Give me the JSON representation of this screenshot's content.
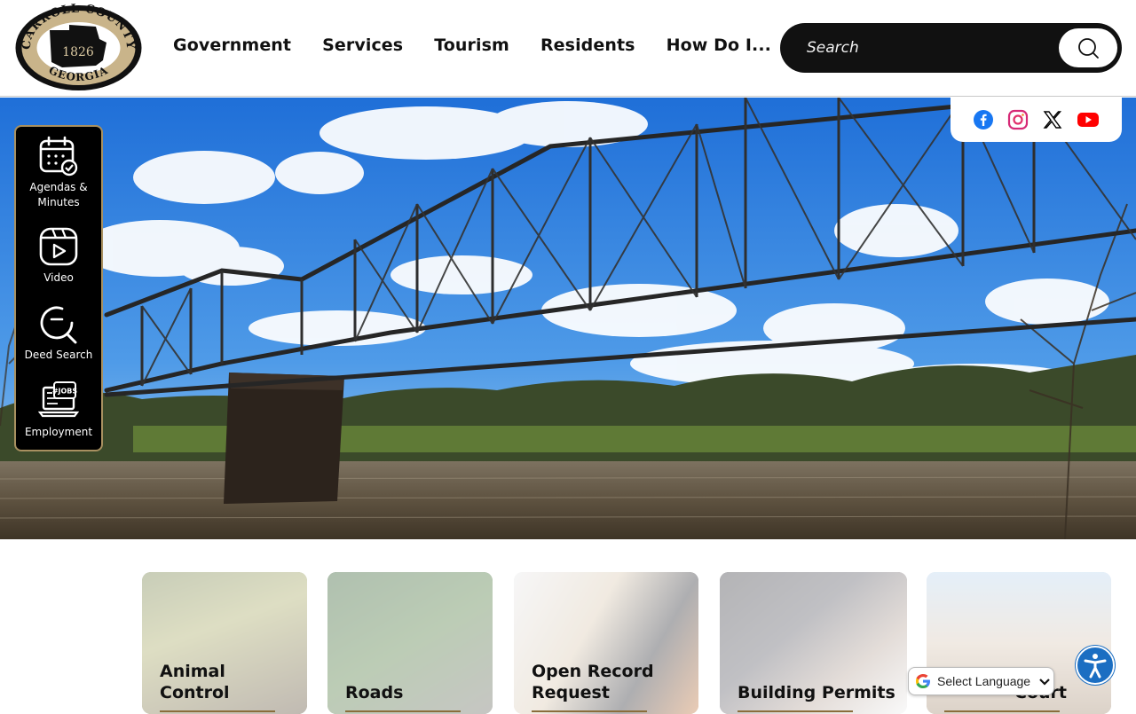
{
  "header": {
    "logo": {
      "top_text": "CARROLL COUNTY",
      "year": "1826",
      "bottom_text": "GEORGIA"
    },
    "nav": [
      {
        "label": "Government"
      },
      {
        "label": "Services"
      },
      {
        "label": "Tourism"
      },
      {
        "label": "Residents"
      },
      {
        "label": "How Do I..."
      }
    ],
    "search": {
      "placeholder": "Search",
      "icon": "search-icon"
    }
  },
  "social": [
    {
      "name": "facebook-icon",
      "color": "#1877f2"
    },
    {
      "name": "instagram-icon",
      "color": "#d62976"
    },
    {
      "name": "x-icon",
      "color": "#000000"
    },
    {
      "name": "youtube-icon",
      "color": "#ff0000"
    }
  ],
  "quick_links": [
    {
      "label": "Agendas & Minutes",
      "icon": "calendar-check-icon"
    },
    {
      "label": "Video",
      "icon": "video-play-icon"
    },
    {
      "label": "Deed Search",
      "icon": "deed-search-icon"
    },
    {
      "label": "Employment",
      "icon": "jobs-laptop-icon"
    }
  ],
  "tiles": [
    {
      "label": "Animal Control"
    },
    {
      "label": "Roads"
    },
    {
      "label": "Open Record Request"
    },
    {
      "label": "Building Permits"
    },
    {
      "label": "Court"
    }
  ],
  "translate": {
    "label": "Select Language"
  },
  "accessibility": {
    "icon": "accessibility-icon",
    "color": "#1b6ec2"
  },
  "colors": {
    "accent_gold": "#a89060",
    "nav_text": "#111111",
    "search_bg": "#111111"
  }
}
